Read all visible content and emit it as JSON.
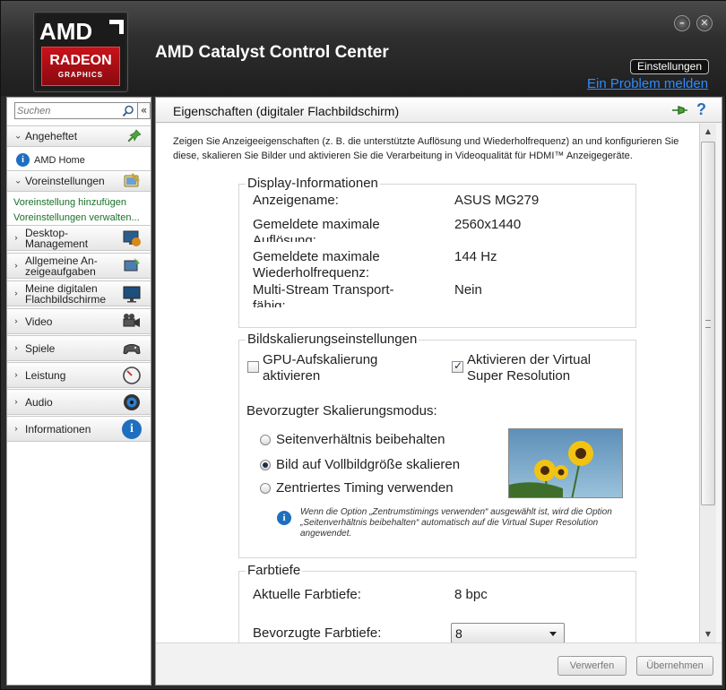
{
  "window": {
    "title": "AMD Catalyst Control Center"
  },
  "logo": {
    "brand": "AMD",
    "line1": "RADEON",
    "line2": "GRAPHICS"
  },
  "header": {
    "settings_label": "Einstellungen",
    "problem_link": "Ein Problem melden",
    "minimize_glyph": "–",
    "close_glyph": "✕"
  },
  "sidebar": {
    "search_placeholder": "Suchen",
    "collapse_glyph": "«",
    "pinned": {
      "label": "Angeheftet",
      "icon": "pin-icon"
    },
    "home": {
      "label": "AMD Home",
      "icon": "info-icon"
    },
    "presets": {
      "label": "Voreinstellungen",
      "icon": "presets-icon",
      "links": [
        "Voreinstellung hinzufügen",
        "Voreinstellungen verwalten..."
      ]
    },
    "items": [
      {
        "label": "Desktop-Management",
        "label2": "Management",
        "label1": "Desktop-",
        "icon": "desktop-management-icon"
      },
      {
        "label1": "Allgemeine An-",
        "label2": "zeigeaufgaben",
        "icon": "display-tasks-icon"
      },
      {
        "label1": "Meine digitalen",
        "label2": "Flachbildschirme",
        "icon": "flat-panel-icon"
      },
      {
        "label1": "Video",
        "label2": "",
        "icon": "video-camera-icon"
      },
      {
        "label1": "Spiele",
        "label2": "",
        "icon": "gamepad-icon"
      },
      {
        "label1": "Leistung",
        "label2": "",
        "icon": "gauge-icon"
      },
      {
        "label1": "Audio",
        "label2": "",
        "icon": "speaker-icon"
      },
      {
        "label1": "Informationen",
        "label2": "",
        "icon": "info-icon"
      }
    ]
  },
  "main": {
    "title": "Eigenschaften (digitaler Flachbildschirm)",
    "description": "Zeigen Sie Anzeigeeigenschaften (z. B. die unterstützte Auflösung und Wiederholfrequenz) an und konfigurieren Sie diese, skalieren Sie Bilder und aktivieren Sie die Verarbeitung in Videoqualität für HDMI™ Anzeigegeräte.",
    "display_info": {
      "title": "Display-Informationen",
      "rows": [
        {
          "label": "Anzeigename:",
          "value": "ASUS MG279"
        },
        {
          "label": "Gemeldete maximale Auflösung:",
          "value": "2560x1440"
        },
        {
          "label": "Gemeldete maximale Wiederholfrequenz:",
          "value": "144 Hz"
        },
        {
          "label": "Multi-Stream Transport-fähig:",
          "value": "Nein"
        }
      ]
    },
    "scaling": {
      "title": "Bildskalierungseinstellungen",
      "gpu_scaling": {
        "label": "GPU-Aufskalierung aktivieren",
        "checked": false
      },
      "vsr": {
        "label": "Aktivieren der Virtual Super Resolution",
        "checked": true
      },
      "mode_label": "Bevorzugter Skalierungsmodus:",
      "modes": [
        {
          "label": "Seitenverhältnis beibehalten",
          "selected": false
        },
        {
          "label": "Bild auf Vollbildgröße skalieren",
          "selected": true
        },
        {
          "label": "Zentriertes Timing verwenden",
          "selected": false
        }
      ],
      "note": "Wenn die Option „Zentrumstimings verwenden“ ausgewählt ist, wird die Option „Seitenverhältnis beibehalten“ automatisch auf die Virtual Super Resolution angewendet."
    },
    "color_depth": {
      "title": "Farbtiefe",
      "current_label": "Aktuelle Farbtiefe:",
      "current_value": "8 bpc",
      "preferred_label": "Bevorzugte Farbtiefe:",
      "preferred_value": "8"
    }
  },
  "footer": {
    "discard_label": "Verwerfen",
    "apply_label": "Übernehmen"
  }
}
